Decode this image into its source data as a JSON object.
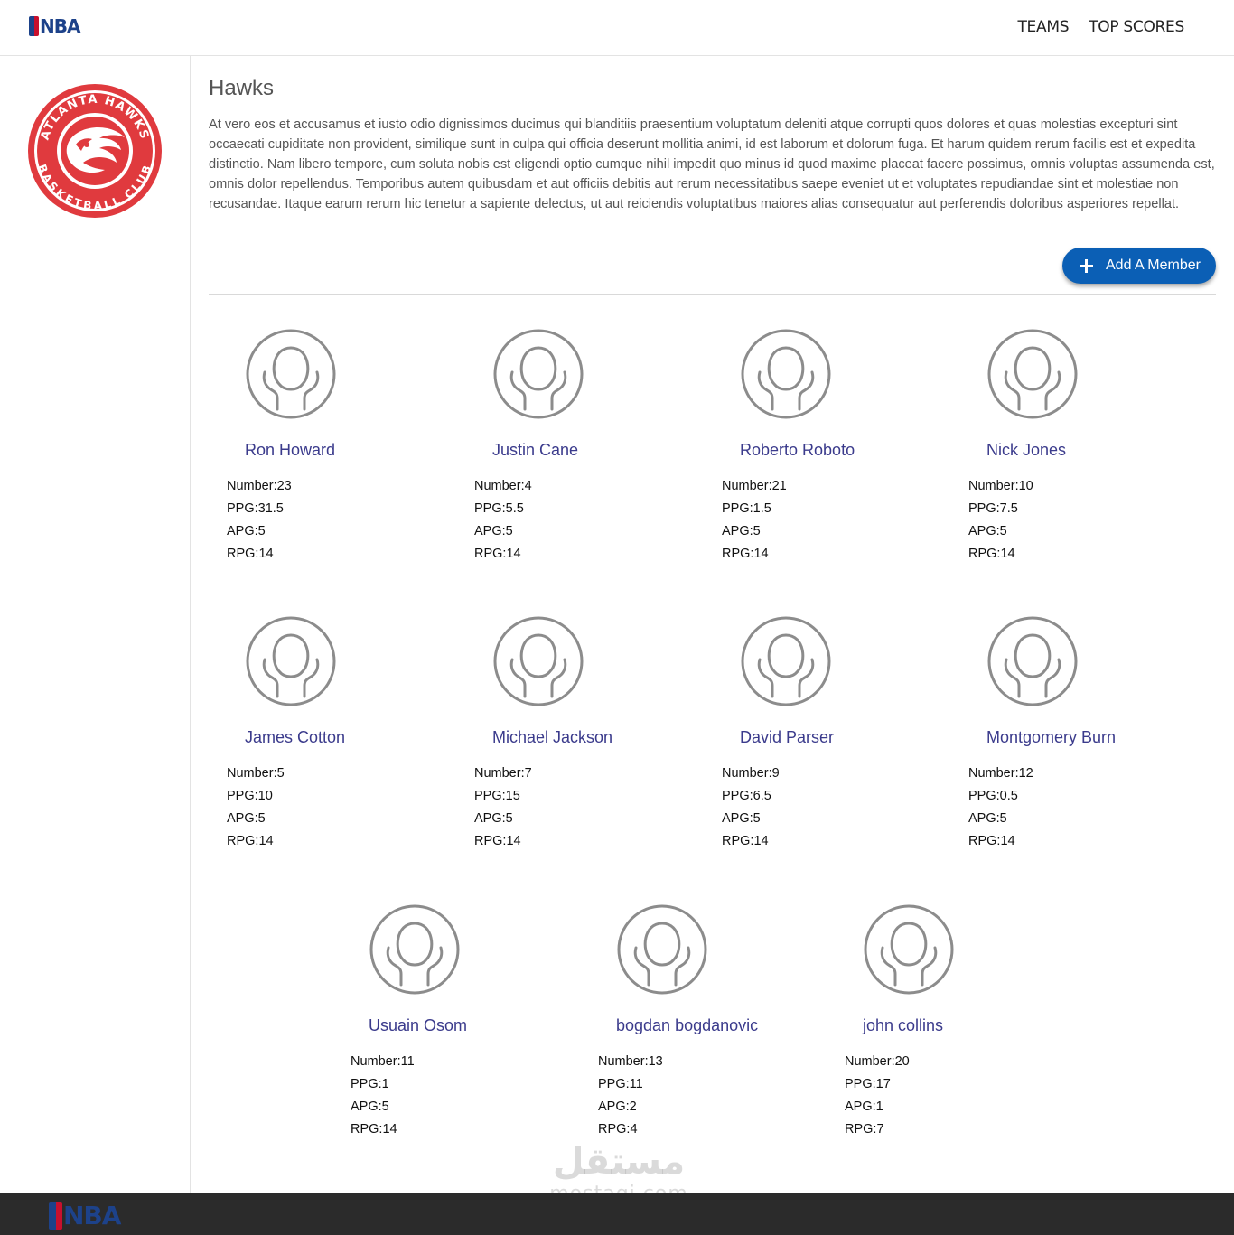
{
  "header": {
    "logo_text": "NBA",
    "nav": [
      {
        "label": "TEAMS"
      },
      {
        "label": "TOP SCORES"
      }
    ]
  },
  "team": {
    "name": "Hawks",
    "logo_ring_text_top": "ATLANTA HAWKS",
    "logo_ring_text_bottom": "BASKETBALL CLUB",
    "description": "At vero eos et accusamus et iusto odio dignissimos ducimus qui blanditiis praesentium voluptatum deleniti atque corrupti quos dolores et quas molestias excepturi sint occaecati cupiditate non provident, similique sunt in culpa qui officia deserunt mollitia animi, id est laborum et dolorum fuga. Et harum quidem rerum facilis est et expedita distinctio. Nam libero tempore, cum soluta nobis est eligendi optio cumque nihil impedit quo minus id quod maxime placeat facere possimus, omnis voluptas assumenda est, omnis dolor repellendus. Temporibus autem quibusdam et aut officiis debitis aut rerum necessitatibus saepe eveniet ut et voluptates repudiandae sint et molestiae non recusandae. Itaque earum rerum hic tenetur a sapiente delectus, ut aut reiciendis voluptatibus maiores alias consequatur aut perferendis doloribus asperiores repellat.",
    "add_button_label": "Add A Member"
  },
  "players": [
    {
      "name": "Ron Howard",
      "number": "Number:23",
      "ppg": "PPG:31.5",
      "apg": "APG:5",
      "rpg": "RPG:14"
    },
    {
      "name": "Justin Cane",
      "number": "Number:4",
      "ppg": "PPG:5.5",
      "apg": "APG:5",
      "rpg": "RPG:14"
    },
    {
      "name": "Roberto Roboto",
      "number": "Number:21",
      "ppg": "PPG:1.5",
      "apg": "APG:5",
      "rpg": "RPG:14"
    },
    {
      "name": "Nick Jones",
      "number": "Number:10",
      "ppg": "PPG:7.5",
      "apg": "APG:5",
      "rpg": "RPG:14"
    },
    {
      "name": "James Cotton",
      "number": "Number:5",
      "ppg": "PPG:10",
      "apg": "APG:5",
      "rpg": "RPG:14"
    },
    {
      "name": "Michael Jackson",
      "number": "Number:7",
      "ppg": "PPG:15",
      "apg": "APG:5",
      "rpg": "RPG:14"
    },
    {
      "name": "David Parser",
      "number": "Number:9",
      "ppg": "PPG:6.5",
      "apg": "APG:5",
      "rpg": "RPG:14"
    },
    {
      "name": "Montgomery Burn",
      "number": "Number:12",
      "ppg": "PPG:0.5",
      "apg": "APG:5",
      "rpg": "RPG:14"
    },
    {
      "name": "Usuain Osom",
      "number": "Number:11",
      "ppg": "PPG:1",
      "apg": "APG:5",
      "rpg": "RPG:14"
    },
    {
      "name": "bogdan bogdanovic",
      "number": "Number:13",
      "ppg": "PPG:11",
      "apg": "APG:2",
      "rpg": "RPG:4"
    },
    {
      "name": "john collins",
      "number": "Number:20",
      "ppg": "PPG:17",
      "apg": "APG:1",
      "rpg": "RPG:7"
    }
  ],
  "footer": {
    "logo_text": "NBA",
    "watermark_arabic": "مستقل",
    "watermark_latin": "mostaqi.com"
  },
  "colors": {
    "accent": "#0b5fb5",
    "player_name": "#3b3b8c",
    "hawks_red": "#e03a3e",
    "footer_bg": "#2b2b2b"
  }
}
